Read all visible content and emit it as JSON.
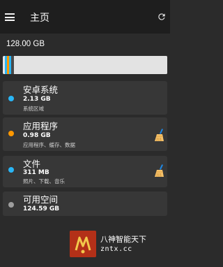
{
  "toolbar": {
    "menu_icon": "hamburger-menu-icon",
    "title": "主页",
    "refresh_icon": "refresh-icon"
  },
  "storage": {
    "total": "128.00 GB",
    "colors": {
      "system": "#29b6f6",
      "apps": "#ff9800",
      "files": "#29b6f6",
      "free": "#9e9e9e"
    }
  },
  "categories": [
    {
      "title": "安卓系统",
      "size": "2.13 GB",
      "desc": "系统区域"
    },
    {
      "title": "应用程序",
      "size": "0.98 GB",
      "desc": "应用程序、缓存、数据",
      "action_icon": "broom-clean-icon"
    },
    {
      "title": "文件",
      "size": "311 MB",
      "desc": "照片、下载、音乐",
      "action_icon": "broom-clean-icon"
    },
    {
      "title": "可用空间",
      "size": "124.59 GB"
    }
  ],
  "watermark": {
    "line1": "八神智能天下",
    "line2": "zntx.cc"
  }
}
